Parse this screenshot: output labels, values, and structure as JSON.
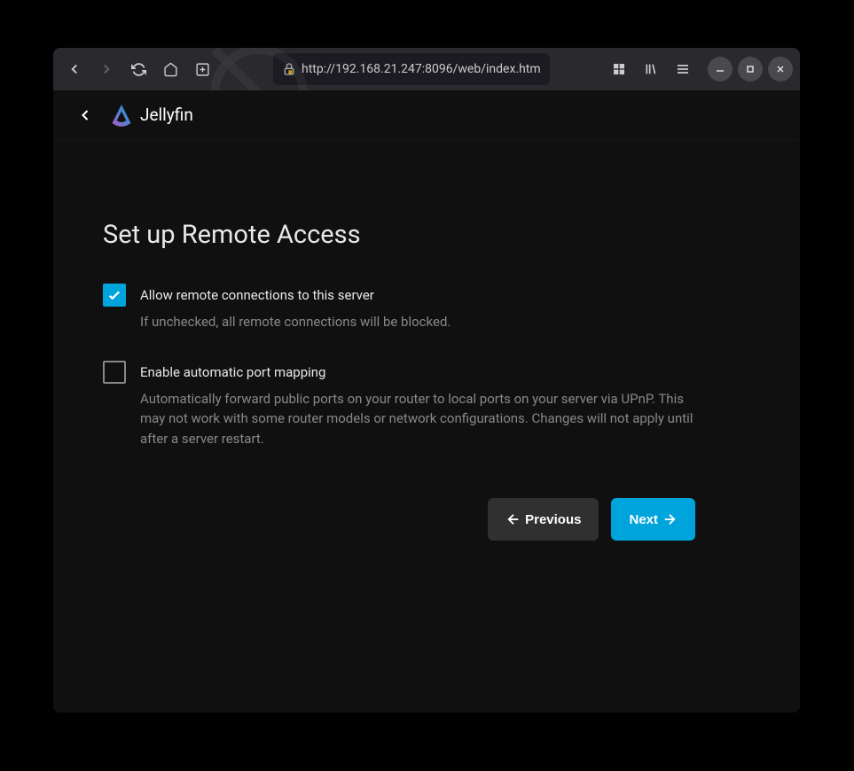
{
  "browser": {
    "url": "http://192.168.21.247:8096/web/index.htm"
  },
  "app": {
    "name": "Jellyfin"
  },
  "page": {
    "title": "Set up Remote Access",
    "options": {
      "allow_remote": {
        "label": "Allow remote connections to this server",
        "description": "If unchecked, all remote connections will be blocked.",
        "checked": true
      },
      "auto_port_mapping": {
        "label": "Enable automatic port mapping",
        "description": "Automatically forward public ports on your router to local ports on your server via UPnP. This may not work with some router models or network configurations. Changes will not apply until after a server restart.",
        "checked": false
      }
    },
    "buttons": {
      "previous": "Previous",
      "next": "Next"
    }
  }
}
